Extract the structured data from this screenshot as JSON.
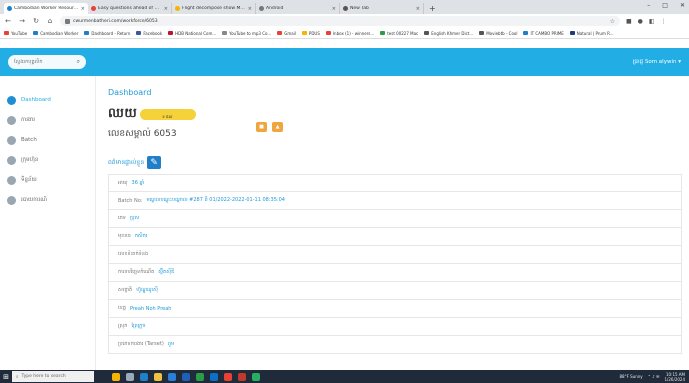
{
  "browser": {
    "tabs": [
      {
        "title": "Cambodian Worker Resource",
        "active": true,
        "color": "#1f7fc8"
      },
      {
        "title": "Easy questions ahead of Rem",
        "active": false,
        "color": "#e94235"
      },
      {
        "title": "Flight decompose show MHDT",
        "active": false,
        "color": "#f5b400"
      },
      {
        "title": "Android",
        "active": false,
        "color": "#777777"
      },
      {
        "title": "New Tab",
        "active": false,
        "color": "#555555"
      }
    ],
    "new_tab_label": "+",
    "url": "cwurmenbatheri.com/workforce/6053",
    "bookmarks": [
      {
        "label": "YouTube",
        "color": "#e94235"
      },
      {
        "label": "Cambodian Worker",
        "color": "#1f7fc8"
      },
      {
        "label": "Dashboard - Return",
        "color": "#1f7fc8"
      },
      {
        "label": "Facebook",
        "color": "#3b5998"
      },
      {
        "label": "HDB National Com...",
        "color": "#c8102e"
      },
      {
        "label": "YouTube to mp3 Co...",
        "color": "#888888"
      },
      {
        "label": "Gmail",
        "color": "#e94235"
      },
      {
        "label": "PDUS",
        "color": "#f5b400"
      },
      {
        "label": "Inbox (1) - winners...",
        "color": "#e94235"
      },
      {
        "label": "test 00227 Mac",
        "color": "#2a9d46"
      },
      {
        "label": "English Khmer Dict...",
        "color": "#555555"
      },
      {
        "label": "Moviebtb - Cool",
        "color": "#555555"
      },
      {
        "label": "IT CAMBO PRIME",
        "color": "#1f7fc8"
      },
      {
        "label": "Natural | Prum R...",
        "color": "#1f3b7a"
      }
    ]
  },
  "app": {
    "search_placeholder": "ស្វែងរកបុគ្គលិក",
    "user_name": "ប្រាជ្ញ Som alywin ▾",
    "sidebar": [
      {
        "label": "Dashboard",
        "active": true
      },
      {
        "label": "ការងារ",
        "active": false
      },
      {
        "label": "Batch",
        "active": false
      },
      {
        "label": "ក្រុមហ៊ុន",
        "active": false
      },
      {
        "label": "ទិន្នន័យ",
        "active": false
      },
      {
        "label": "របាយការណ៍",
        "active": false
      }
    ],
    "breadcrumb": "Dashboard",
    "worker_name": "ឈយ",
    "redacted_tail": "ទ ផល",
    "account_label": "លេខសម្គាល់ 6053",
    "btn_left": "■",
    "btn_right": "▲",
    "section_title": "ពត៌មានផ្ទាល់ខ្លួន",
    "rows": [
      {
        "label": "អាយុ",
        "value": "36 ឆ្នាំ"
      },
      {
        "label": "Batch No:",
        "value": "មណ្ឌលបណ្តុះបណ្តាល #287 ពី 01/2022-2022-01-11 08:35:04"
      },
      {
        "label": "ភេទ",
        "value": "ប្រុស"
      },
      {
        "label": "មុខរបរ",
        "value": "កសិករ"
      },
      {
        "label": "លេខទំនាក់ទំនង",
        "value": ""
      },
      {
        "label": "កាលបរិច្ឆេទកំណើត",
        "value": "ស្វ៊ីតស៊ីឌី"
      },
      {
        "label": "សញ្ជាតិ",
        "value": "ហ៊ូណ្ឌូណូស៊ី"
      },
      {
        "label": "ខេត្ត",
        "value": "Preah Noh Preah"
      },
      {
        "label": "ស្រុក",
        "value": "ព្រៃក្រូច"
      },
      {
        "label": "ប្រភេទការងារ (Tarset)",
        "value": "ពួម"
      }
    ]
  },
  "taskbar": {
    "search_placeholder": "Type here to search",
    "weather": "88°F Sunny",
    "time": "10:15 AM",
    "date": "1/26/2024"
  }
}
